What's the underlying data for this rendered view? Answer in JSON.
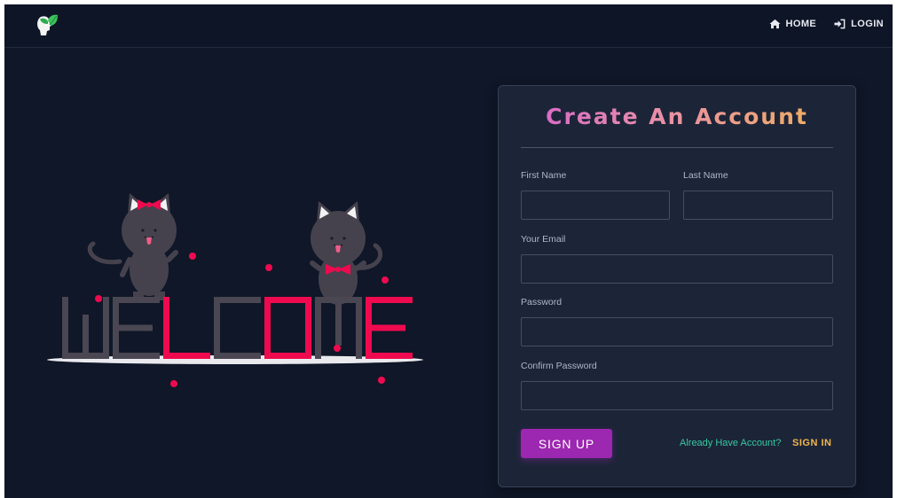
{
  "nav": {
    "logo_icon": "leaf-head-logo-icon",
    "links": [
      {
        "label": "HOME",
        "icon": "home-icon"
      },
      {
        "label": "LOGIN",
        "icon": "sign-in-icon"
      }
    ]
  },
  "illustration": {
    "word": "WELCOME",
    "letters": [
      "W",
      "E",
      "L",
      "C",
      "O",
      "M",
      "E"
    ],
    "letter_colors": [
      "#4a4652",
      "#4a4652",
      "#ef0a4f",
      "#4a4652",
      "#ef0a4f",
      "#4a4652",
      "#ef0a4f"
    ],
    "accent_color": "#ef0a4f",
    "cat_color": "#46424d"
  },
  "form": {
    "title": "Create An Account",
    "first_name_label": "First Name",
    "last_name_label": "Last Name",
    "email_label": "Your Email",
    "password_label": "Password",
    "confirm_password_label": "Confirm Password",
    "first_name_value": "",
    "last_name_value": "",
    "email_value": "",
    "password_value": "",
    "confirm_password_value": "",
    "submit_label": "SIGN UP",
    "already_text": "Already Have Account?",
    "signin_label": "SIGN IN"
  },
  "colors": {
    "background": "#0f1728",
    "card": "#1c2538",
    "button": "#9c27b0",
    "link_green": "#35c9a1",
    "link_gold": "#f2b64c"
  }
}
